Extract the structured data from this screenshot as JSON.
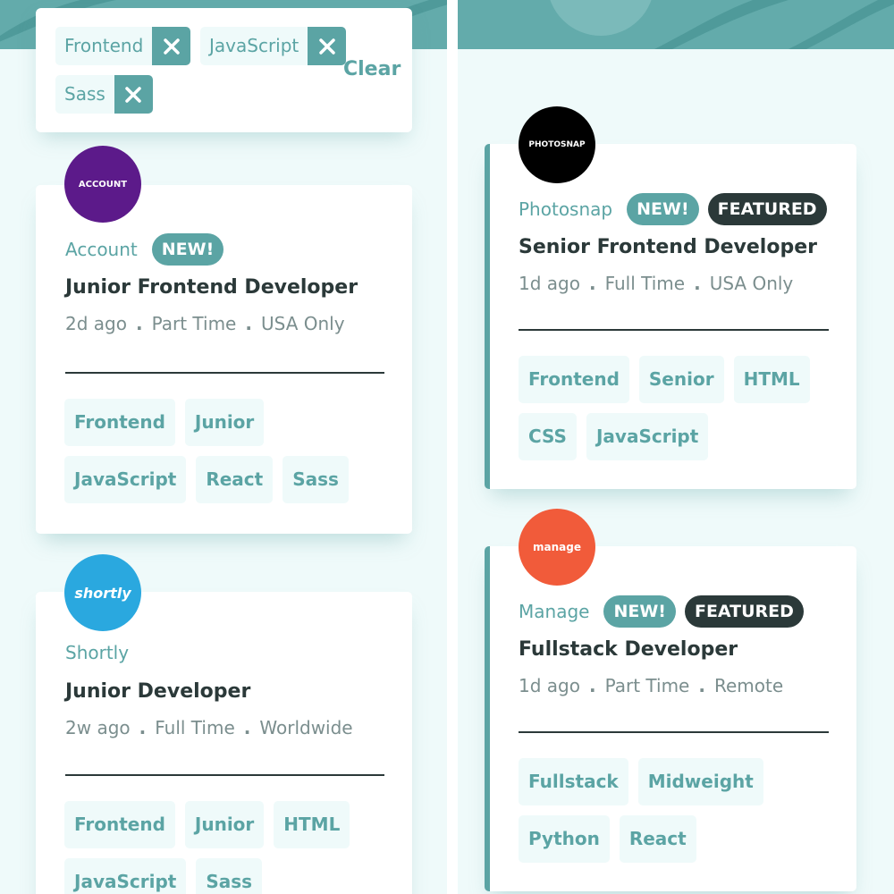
{
  "colors": {
    "primary": "#5ba4a4",
    "bg": "#effafa",
    "dark": "#2b3939",
    "muted": "#7b8e8e"
  },
  "filter": {
    "chips": [
      {
        "label": "Frontend",
        "icon": "close-icon"
      },
      {
        "label": "JavaScript",
        "icon": "close-icon"
      },
      {
        "label": "Sass",
        "icon": "close-icon"
      }
    ],
    "clear_label": "Clear"
  },
  "jobs": [
    {
      "company": "Account",
      "logo_text": "ACCOUNT",
      "logo_color": "#5c1a8a",
      "new": "NEW!",
      "featured": "",
      "position": "Junior Frontend Developer",
      "posted": "2d ago",
      "contract": "Part Time",
      "location": "USA Only",
      "tags": [
        "Frontend",
        "Junior",
        "JavaScript",
        "React",
        "Sass"
      ]
    },
    {
      "company": "Shortly",
      "logo_text": "shortly",
      "logo_color": "#2aa8df",
      "new": "",
      "featured": "",
      "position": "Junior Developer",
      "posted": "2w ago",
      "contract": "Full Time",
      "location": "Worldwide",
      "tags": [
        "Frontend",
        "Junior",
        "HTML",
        "JavaScript",
        "Sass"
      ]
    },
    {
      "company": "Photosnap",
      "logo_text": "PHOTOSNAP",
      "logo_color": "#000000",
      "new": "NEW!",
      "featured": "FEATURED",
      "position": "Senior Frontend Developer",
      "posted": "1d ago",
      "contract": "Full Time",
      "location": "USA Only",
      "tags": [
        "Frontend",
        "Senior",
        "HTML",
        "CSS",
        "JavaScript"
      ]
    },
    {
      "company": "Manage",
      "logo_text": "manage",
      "logo_color": "#f15b3a",
      "new": "NEW!",
      "featured": "FEATURED",
      "position": "Fullstack Developer",
      "posted": "1d ago",
      "contract": "Part Time",
      "location": "Remote",
      "tags": [
        "Fullstack",
        "Midweight",
        "Python",
        "React"
      ]
    }
  ],
  "meta_separator": "."
}
